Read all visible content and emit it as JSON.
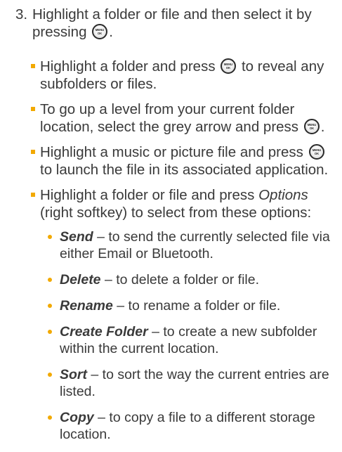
{
  "step": {
    "number": "3.",
    "text_a": "Highlight a folder or file and then select it by pressing",
    "text_b": "."
  },
  "key_icon": {
    "top_text": "MENU",
    "bottom_text": "OK"
  },
  "bullets": [
    {
      "text_a": "Highlight a folder and press",
      "text_b": "to reveal any subfolders or files."
    },
    {
      "text_a": "To go up a level from your current folder location, select the grey arrow and press",
      "text_b": "."
    },
    {
      "text_a": "Highlight a music or picture file and press",
      "text_b": "to launch the file in its associated application."
    },
    {
      "text_a": "Highlight a folder or file and press",
      "options_word": "Options",
      "text_b": "(right softkey) to select from these options:"
    }
  ],
  "options": [
    {
      "term": "Send",
      "desc": "– to send the currently selected file via either Email or Bluetooth."
    },
    {
      "term": "Delete",
      "desc": "– to delete a folder or file."
    },
    {
      "term": "Rename",
      "desc": "– to rename a folder or file."
    },
    {
      "term": "Create Folder",
      "desc": "– to create a new subfolder within the current location."
    },
    {
      "term": "Sort",
      "desc": "– to sort the way the current entries are listed."
    },
    {
      "term": "Copy",
      "desc": "– to copy a file to a different storage location."
    }
  ],
  "colors": {
    "text": "#3a3a3a",
    "bullet_accent": "#f2a900"
  }
}
